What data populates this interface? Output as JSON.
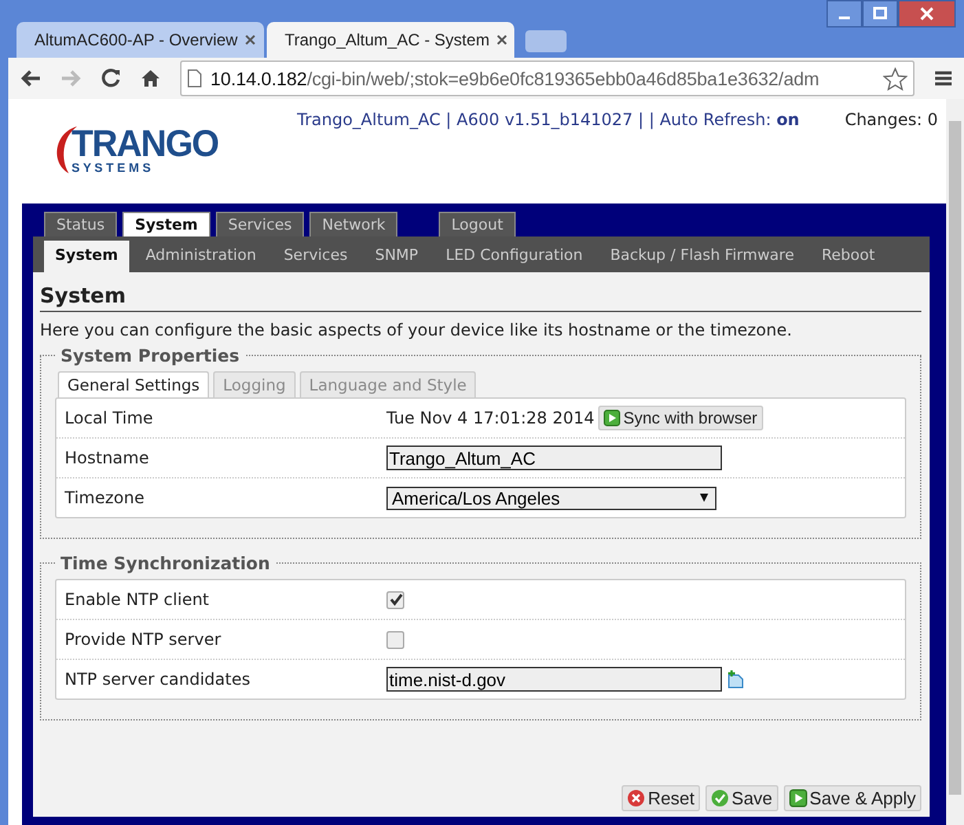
{
  "browser": {
    "tabs": [
      {
        "title": "AltumAC600-AP - Overview",
        "selected": false
      },
      {
        "title": "Trango_Altum_AC - System",
        "selected": true
      }
    ],
    "url": {
      "host": "10.14.0.182",
      "path": "/cgi-bin/web/;stok=e9b6e0fc819365ebb0a46d85ba1e3632/adm"
    }
  },
  "header": {
    "logo_text": "TRANGO",
    "logo_subtext": "S Y S T E M S",
    "info": "Trango_Altum_AC | A600 v1.51_b141027 | | Auto Refresh: **on**",
    "changes": "Changes: 0"
  },
  "main_tabs": [
    {
      "label": "Status",
      "selected": false
    },
    {
      "label": "System",
      "selected": true
    },
    {
      "label": "Services",
      "selected": false
    },
    {
      "label": "Network",
      "selected": false
    },
    {
      "label": "Logout",
      "selected": false
    }
  ],
  "sub_tabs": [
    {
      "label": "System",
      "selected": true
    },
    {
      "label": "Administration",
      "selected": false
    },
    {
      "label": "Services",
      "selected": false
    },
    {
      "label": "SNMP",
      "selected": false
    },
    {
      "label": "LED Configuration",
      "selected": false
    },
    {
      "label": "Backup / Flash Firmware",
      "selected": false
    },
    {
      "label": "Reboot",
      "selected": false
    }
  ],
  "page": {
    "title": "System",
    "description": "Here you can configure the basic aspects of your device like its hostname or the timezone."
  },
  "sections": [
    {
      "title": "System Properties",
      "tabs": [
        {
          "label": "General Settings",
          "selected": true
        },
        {
          "label": "Logging",
          "selected": false
        },
        {
          "label": "Language and Style",
          "selected": false
        }
      ],
      "rows": [
        {
          "kind": "time",
          "label": "Local Time",
          "value": "Tue Nov 4 17:01:28 2014",
          "button": "Sync with browser"
        },
        {
          "kind": "text",
          "label": "Hostname",
          "value": "Trango_Altum_AC"
        },
        {
          "kind": "select",
          "label": "Timezone",
          "value": "America/Los Angeles"
        }
      ]
    },
    {
      "title": "Time Synchronization",
      "rows": [
        {
          "kind": "checkbox",
          "label": "Enable NTP client",
          "checked": true
        },
        {
          "kind": "checkbox",
          "label": "Provide NTP server",
          "checked": false
        },
        {
          "kind": "list",
          "label": "NTP server candidates",
          "value": "time.nist-d.gov"
        }
      ]
    }
  ],
  "buttons": [
    {
      "kind": "reset",
      "label": "Reset"
    },
    {
      "kind": "save",
      "label": "Save"
    },
    {
      "kind": "apply",
      "label": "Save & Apply"
    }
  ]
}
